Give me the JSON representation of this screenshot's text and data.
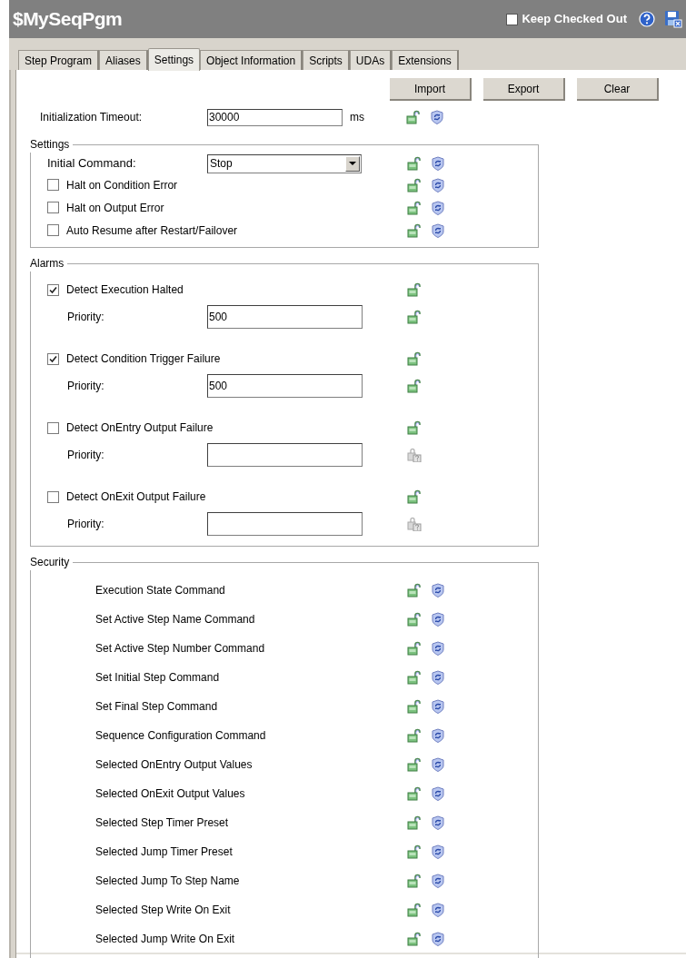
{
  "title": "$MySeqPgm",
  "keep_checked_out": {
    "label": "Keep Checked Out",
    "checked": false
  },
  "tabs": [
    {
      "label": "Step Program",
      "selected": false
    },
    {
      "label": "Aliases",
      "selected": false
    },
    {
      "label": "Settings",
      "selected": true
    },
    {
      "label": "Object Information",
      "selected": false
    },
    {
      "label": "Scripts",
      "selected": false
    },
    {
      "label": "UDAs",
      "selected": false
    },
    {
      "label": "Extensions",
      "selected": false
    }
  ],
  "buttons": [
    "Import",
    "Export",
    "Clear"
  ],
  "timeout": {
    "label": "Initialization Timeout:",
    "value": "30000",
    "unit": "ms",
    "lock_enabled": true,
    "propagate": true
  },
  "settings": {
    "title": "Settings",
    "rows": [
      {
        "kind": "dropdown",
        "label": "Initial Command:",
        "value": "Stop",
        "lock_enabled": true,
        "propagate": true
      },
      {
        "kind": "checkbox",
        "label": "Halt on Condition Error",
        "checked": false,
        "lock_enabled": true,
        "propagate": true
      },
      {
        "kind": "checkbox",
        "label": "Halt on Output Error",
        "checked": false,
        "lock_enabled": true,
        "propagate": true
      },
      {
        "kind": "checkbox",
        "label": "Auto Resume after Restart/Failover",
        "checked": false,
        "lock_enabled": true,
        "propagate": true
      }
    ]
  },
  "alarms": {
    "title": "Alarms",
    "items": [
      {
        "label": "Detect Execution Halted",
        "checked": true,
        "lock_enabled": true,
        "priority": {
          "label": "Priority:",
          "value": "500",
          "lock_enabled": true
        }
      },
      {
        "label": "Detect Condition Trigger Failure",
        "checked": true,
        "lock_enabled": true,
        "priority": {
          "label": "Priority:",
          "value": "500",
          "lock_enabled": true
        }
      },
      {
        "label": "Detect OnEntry Output Failure",
        "checked": false,
        "lock_enabled": true,
        "priority": {
          "label": "Priority:",
          "lock_enabled": false
        }
      },
      {
        "label": "Detect OnExit Output Failure",
        "checked": false,
        "lock_enabled": true,
        "priority": {
          "label": "Priority:",
          "lock_enabled": false
        }
      }
    ]
  },
  "security": {
    "title": "Security",
    "rows": [
      {
        "label": "Execution State Command",
        "lock_enabled": true,
        "propagate": true
      },
      {
        "label": "Set Active Step Name Command",
        "lock_enabled": true,
        "propagate": true
      },
      {
        "label": "Set Active Step Number Command",
        "lock_enabled": true,
        "propagate": true
      },
      {
        "label": "Set Initial Step Command",
        "lock_enabled": true,
        "propagate": true
      },
      {
        "label": "Set Final Step Command",
        "lock_enabled": true,
        "propagate": true
      },
      {
        "label": "Sequence Configuration Command",
        "lock_enabled": true,
        "propagate": true
      },
      {
        "label": "Selected OnEntry Output Values",
        "lock_enabled": true,
        "propagate": true
      },
      {
        "label": "Selected OnExit Output Values",
        "lock_enabled": true,
        "propagate": true
      },
      {
        "label": "Selected Step Timer Preset",
        "lock_enabled": true,
        "propagate": true
      },
      {
        "label": "Selected Jump Timer Preset",
        "lock_enabled": true,
        "propagate": true
      },
      {
        "label": "Selected Jump To Step Name",
        "lock_enabled": true,
        "propagate": true
      },
      {
        "label": "Selected Step Write On Exit",
        "lock_enabled": true,
        "propagate": true
      },
      {
        "label": "Selected Jump Write On Exit",
        "lock_enabled": true,
        "propagate": true
      }
    ]
  }
}
